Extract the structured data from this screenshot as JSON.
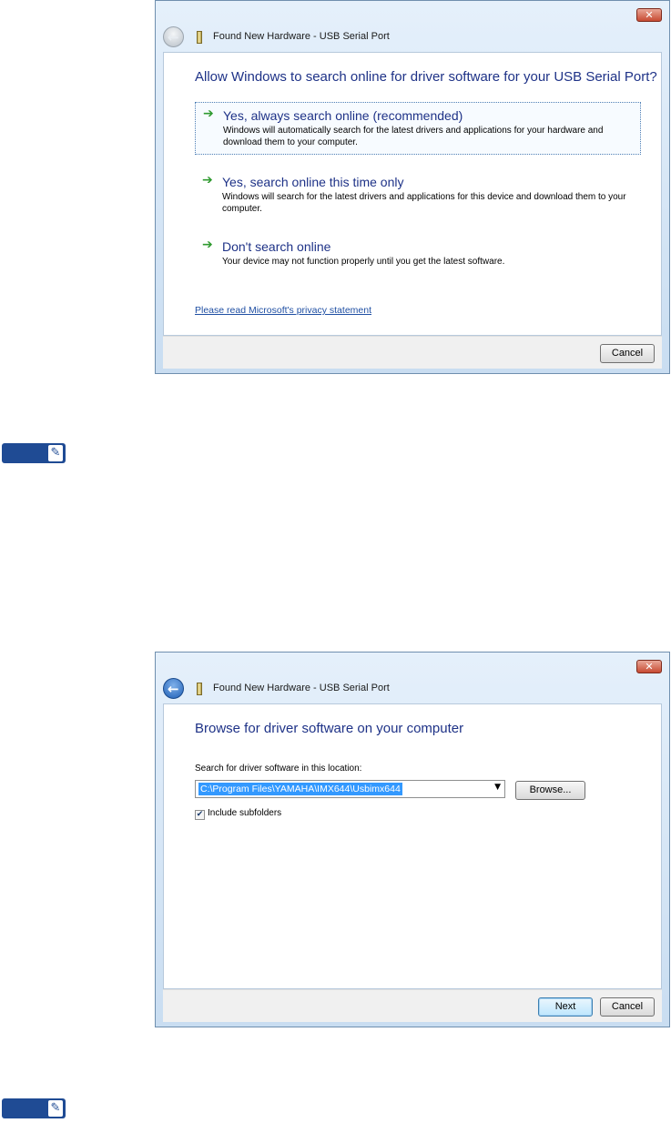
{
  "dialog1": {
    "title": "Found New Hardware - USB Serial Port",
    "heading": "Allow Windows to search online for driver software for your USB Serial Port?",
    "options": [
      {
        "title": "Yes, always search online (recommended)",
        "desc": "Windows will automatically search for the latest drivers and applications for your hardware and download them to your computer."
      },
      {
        "title": "Yes, search online this time only",
        "desc": "Windows will search for the latest drivers and applications for this device and download them to your computer."
      },
      {
        "title": "Don't search online",
        "desc": "Your device may not function properly until you get the latest software."
      }
    ],
    "privacy_link": "Please read Microsoft's  privacy statement",
    "cancel_label": "Cancel"
  },
  "dialog2": {
    "title": "Found New Hardware - USB Serial Port",
    "heading": "Browse for driver software on your computer",
    "search_label": "Search for driver software in this location:",
    "path_value": "C:\\Program Files\\YAMAHA\\IMX644\\Usbimx644",
    "browse_label": "Browse...",
    "include_subfolders_label": "Include subfolders",
    "include_subfolders_checked": true,
    "next_label": "Next",
    "cancel_label": "Cancel"
  },
  "icons": {
    "close": "close-icon",
    "back": "back-arrow-icon",
    "device": "usb-device-icon",
    "option_arrow": "green-arrow-icon",
    "note": "pencil-icon"
  },
  "colors": {
    "heading": "#1e3287",
    "link": "#1f4fa3",
    "note_badge": "#1f4b94",
    "option_arrow": "#2f9a2f"
  }
}
